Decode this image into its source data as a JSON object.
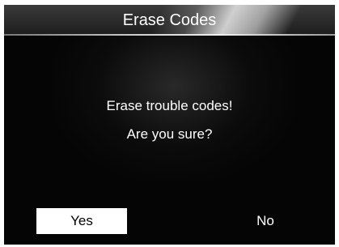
{
  "header": {
    "title": "Erase Codes"
  },
  "dialog": {
    "line1": "Erase trouble codes!",
    "line2": "Are you sure?"
  },
  "buttons": {
    "yes_label": "Yes",
    "no_label": "No"
  },
  "colors": {
    "screen_background": "#050505",
    "text": "#ffffff",
    "selected_button_background": "#ffffff",
    "selected_button_text": "#000000"
  }
}
